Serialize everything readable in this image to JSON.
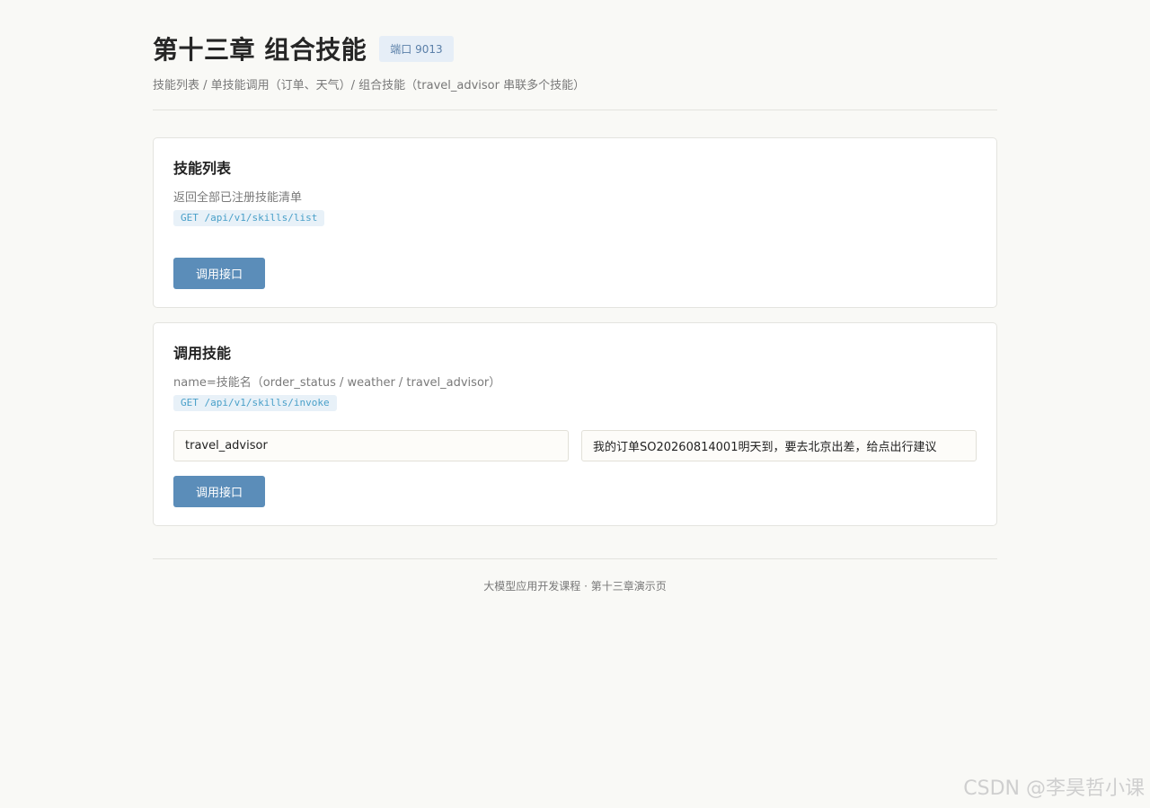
{
  "header": {
    "title": "第十三章 组合技能",
    "port_badge": "端口 9013",
    "breadcrumb": "技能列表 / 单技能调用（订单、天气）/ 组合技能（travel_advisor 串联多个技能）"
  },
  "cards": [
    {
      "title": "技能列表",
      "description": "返回全部已注册技能清单",
      "endpoint": "GET /api/v1/skills/list",
      "button_label": "调用接口"
    },
    {
      "title": "调用技能",
      "description": "name=技能名（order_status / weather / travel_advisor）",
      "endpoint": "GET /api/v1/skills/invoke",
      "inputs": {
        "name_value": "travel_advisor",
        "query_value": "我的订单SO20260814001明天到，要去北京出差，给点出行建议"
      },
      "button_label": "调用接口"
    }
  ],
  "footer": {
    "text": "大模型应用开发课程 · 第十三章演示页"
  },
  "watermark": "CSDN @李昊哲小课",
  "colors": {
    "background": "#f9f9f6",
    "button": "#5b8db9",
    "badge_bg": "#e6eef7",
    "endpoint_text": "#4aa0c9"
  }
}
